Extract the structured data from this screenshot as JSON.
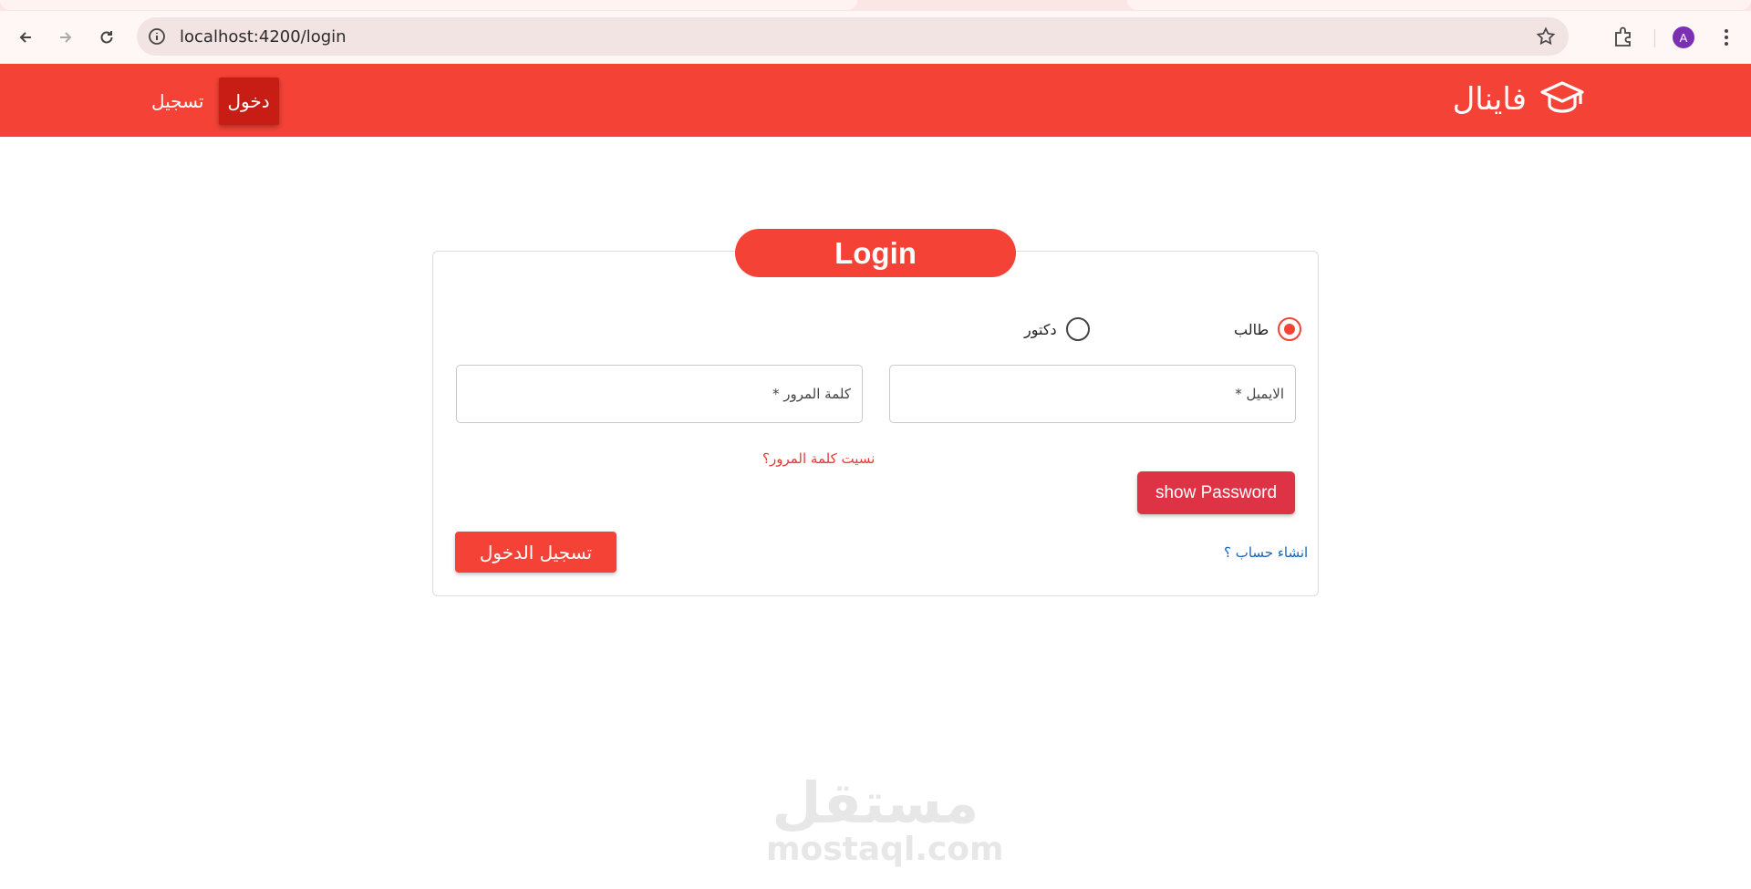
{
  "browser": {
    "url": "localhost:4200/login",
    "profile_initial": "A"
  },
  "header": {
    "brand": "فاينال",
    "nav": {
      "login": "دخول",
      "register": "تسجيل"
    }
  },
  "login": {
    "title": "Login",
    "roles": [
      {
        "label": "طالب",
        "checked": true
      },
      {
        "label": "دكتور",
        "checked": false
      }
    ],
    "email_placeholder": "الايميل *",
    "password_placeholder": "كلمة المرور *",
    "forgot_password": "نسيت كلمة المرور؟",
    "show_password": "show Password",
    "create_account": "انشاء حساب ؟",
    "submit": "تسجيل الدخول"
  },
  "watermark": {
    "arabic": "مستقل",
    "latin": "mostaql.com"
  },
  "colors": {
    "primary": "#f44336",
    "active_nav": "#c81d14",
    "show_password_btn": "#dd3345",
    "link_blue": "#1565c0"
  }
}
